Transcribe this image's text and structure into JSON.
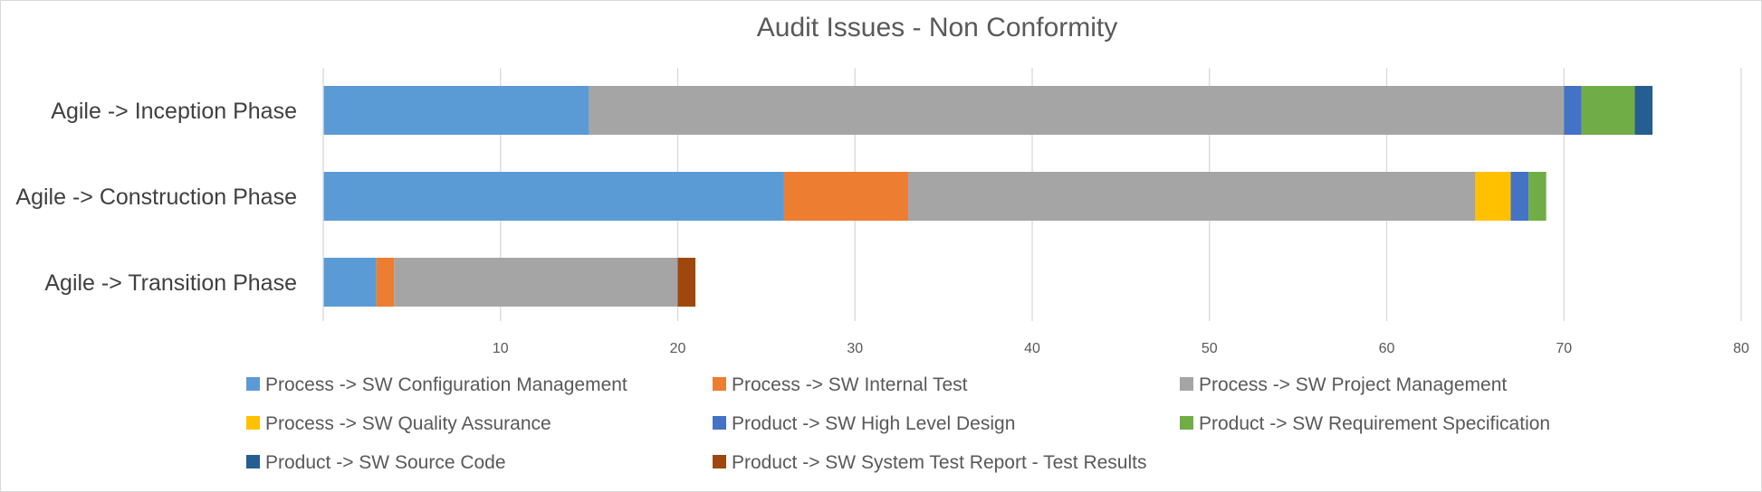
{
  "chart_data": {
    "type": "bar",
    "orientation": "horizontal",
    "stacked": true,
    "title": "Audit Issues - Non Conformity",
    "xlabel": "",
    "ylabel": "",
    "xlim": [
      0,
      80
    ],
    "xticks": [
      10,
      20,
      30,
      40,
      50,
      60,
      70,
      80
    ],
    "grid": true,
    "legend_position": "bottom",
    "categories": [
      "Agile -> Inception Phase",
      "Agile -> Construction Phase",
      "Agile -> Transition Phase"
    ],
    "series": [
      {
        "name": "Process -> SW Configuration Management",
        "color": "#5B9BD5",
        "values": [
          15,
          26,
          3
        ]
      },
      {
        "name": "Process -> SW Internal Test",
        "color": "#ED7D31",
        "values": [
          0,
          7,
          1
        ]
      },
      {
        "name": "Process -> SW Project Management",
        "color": "#A5A5A5",
        "values": [
          55,
          32,
          16
        ]
      },
      {
        "name": "Process -> SW Quality Assurance",
        "color": "#FFC000",
        "values": [
          0,
          2,
          0
        ]
      },
      {
        "name": "Product -> SW High Level Design",
        "color": "#4472C4",
        "values": [
          1,
          1,
          0
        ]
      },
      {
        "name": "Product -> SW Requirement Specification",
        "color": "#70AD47",
        "values": [
          3,
          1,
          0
        ]
      },
      {
        "name": "Product -> SW Source Code",
        "color": "#255E91",
        "values": [
          1,
          0,
          0
        ]
      },
      {
        "name": "Product -> SW System Test Report - Test Results",
        "color": "#9E480E",
        "values": [
          0,
          0,
          1
        ]
      }
    ]
  }
}
